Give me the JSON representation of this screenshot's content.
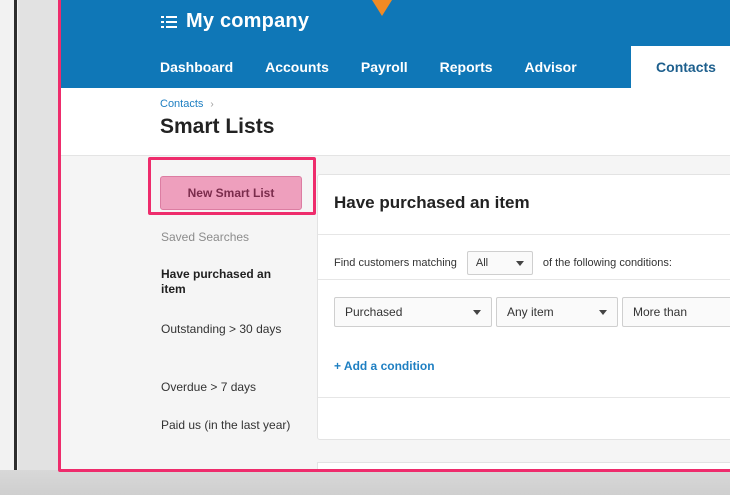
{
  "header": {
    "company": "My company",
    "tabs": [
      "Dashboard",
      "Accounts",
      "Payroll",
      "Reports",
      "Advisor"
    ],
    "active_tab": "Contacts"
  },
  "breadcrumb": {
    "parent": "Contacts",
    "separator": "›"
  },
  "page": {
    "title": "Smart Lists"
  },
  "sidebar": {
    "new_button": "New Smart List",
    "section_label": "Saved Searches",
    "items": [
      {
        "label": "Have purchased an item",
        "active": true
      },
      {
        "label": "Outstanding > 30 days",
        "active": false
      },
      {
        "label": "Overdue > 7 days",
        "active": false
      },
      {
        "label": "Paid us (in the last year)",
        "active": false
      }
    ]
  },
  "panel": {
    "title": "Have purchased an item",
    "match_prefix": "Find customers matching",
    "match_value": "All",
    "match_suffix": "of the following conditions:",
    "conditions": [
      {
        "field": "Purchased",
        "item": "Any item",
        "comparison": "More than"
      }
    ],
    "add_condition": "+ Add a condition"
  },
  "colors": {
    "brand_blue": "#0f77b7",
    "highlight_pink": "#ee2c6c",
    "button_pink": "#ee9fbd",
    "link_blue": "#1e7fc2",
    "arrow_orange": "#f08a24"
  }
}
